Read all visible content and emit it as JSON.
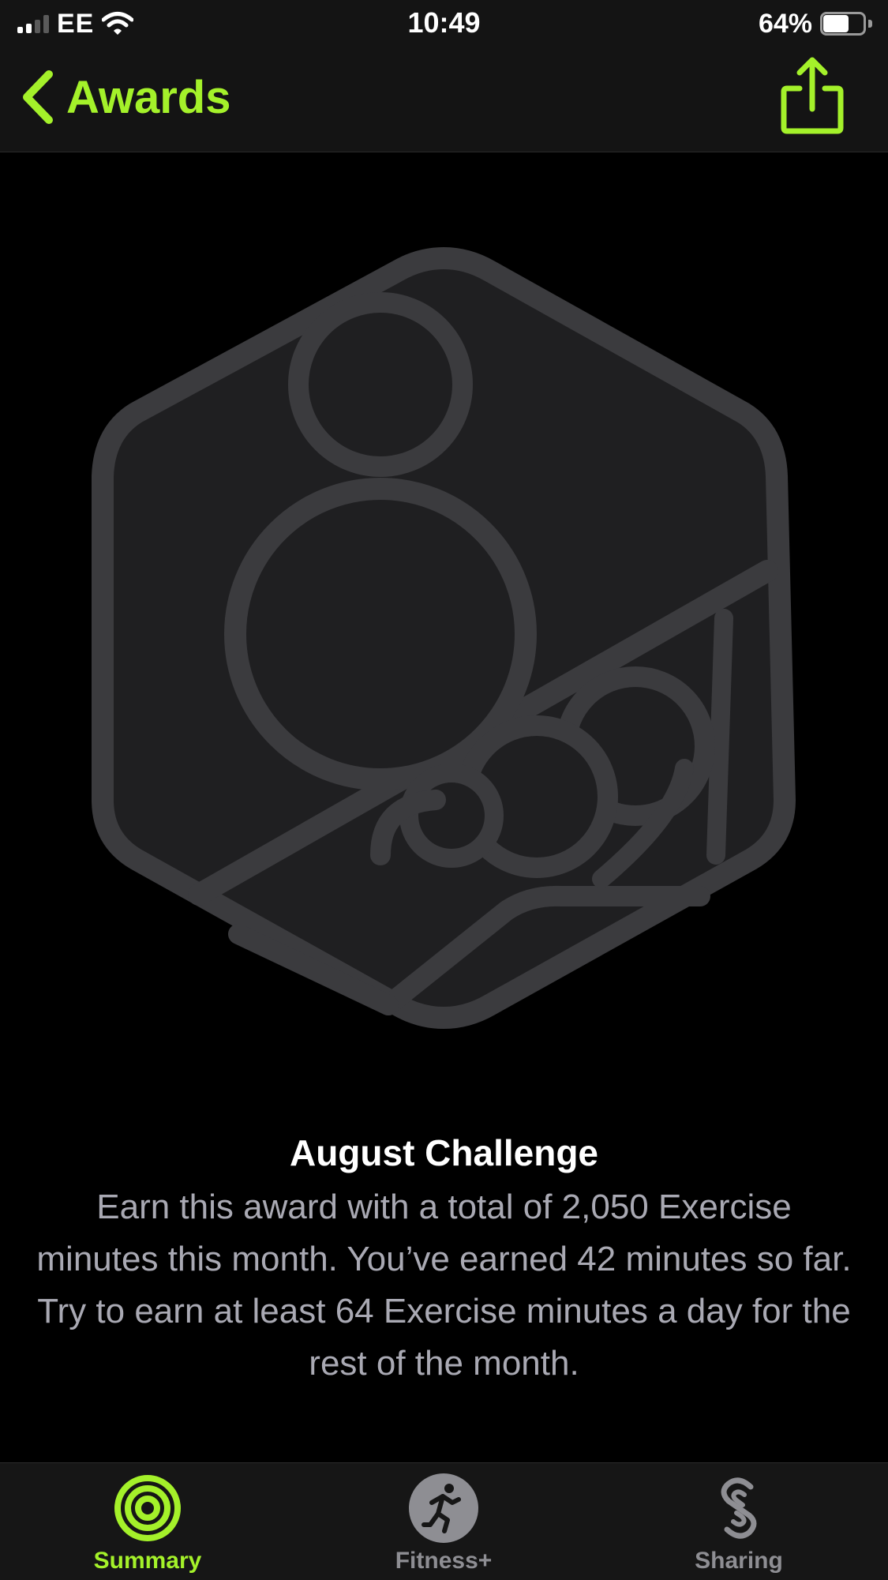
{
  "status_bar": {
    "carrier": "EE",
    "time": "10:49",
    "battery_percent": "64%",
    "battery_level": 0.64
  },
  "nav": {
    "back_label": "Awards",
    "share_icon": "share-icon"
  },
  "award": {
    "title": "August Challenge",
    "description": "Earn this award with a total of 2,050 Exercise minutes this month. You’ve earned 42 minutes so far. Try to earn at least 64 Exercise minutes a day for the rest of the month."
  },
  "tabs": [
    {
      "label": "Summary",
      "icon": "activity-rings-icon",
      "active": true
    },
    {
      "label": "Fitness+",
      "icon": "running-figure-icon",
      "active": false
    },
    {
      "label": "Sharing",
      "icon": "sharing-icon",
      "active": false
    }
  ],
  "colors": {
    "accent": "#a4f12a",
    "badge_fill": "#1f1f21",
    "badge_stroke": "#3b3b3e",
    "description_text": "#a9a9b3",
    "inactive_tab": "#8e8e93"
  }
}
